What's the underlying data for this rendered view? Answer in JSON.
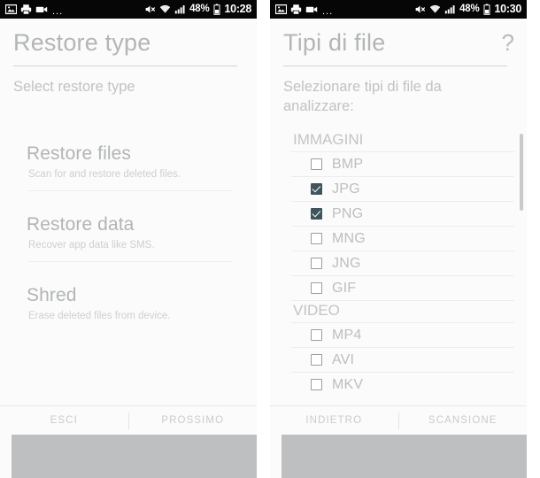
{
  "panels": [
    {
      "id": "restore-type",
      "statusbar": {
        "icons": [
          "image-icon",
          "print-icon",
          "video-icon"
        ],
        "overflow": "...",
        "mute_icon": "mute-icon",
        "wifi_icon": "wifi-icon",
        "signal_icon": "signal-icon",
        "battery_pct": "48%",
        "battery_icon": "battery-icon",
        "time": "10:28"
      },
      "header": {
        "title": "Restore type",
        "help": "",
        "subtitle": "Select restore type"
      },
      "menu": [
        {
          "title": "Restore files",
          "subtitle": "Scan for and restore deleted files."
        },
        {
          "title": "Restore data",
          "subtitle": "Recover app data like SMS."
        },
        {
          "title": "Shred",
          "subtitle": "Erase deleted files from device."
        }
      ],
      "actions": {
        "left": "ESCI",
        "right": "PROSSIMO"
      }
    },
    {
      "id": "file-types",
      "statusbar": {
        "icons": [
          "image-icon",
          "print-icon",
          "video-icon"
        ],
        "overflow": "...",
        "mute_icon": "mute-icon",
        "wifi_icon": "wifi-icon",
        "signal_icon": "signal-icon",
        "battery_pct": "48%",
        "battery_icon": "battery-icon",
        "time": "10:30"
      },
      "header": {
        "title": "Tipi di file",
        "help": "?",
        "subtitle": "Selezionare tipi di file da analizzare:"
      },
      "groups": [
        {
          "name": "IMMAGINI",
          "items": [
            {
              "label": "BMP",
              "checked": false
            },
            {
              "label": "JPG",
              "checked": true
            },
            {
              "label": "PNG",
              "checked": true
            },
            {
              "label": "MNG",
              "checked": false
            },
            {
              "label": "JNG",
              "checked": false
            },
            {
              "label": "GIF",
              "checked": false
            }
          ]
        },
        {
          "name": "VIDEO",
          "items": [
            {
              "label": "MP4",
              "checked": false
            },
            {
              "label": "AVI",
              "checked": false
            },
            {
              "label": "MKV",
              "checked": false
            }
          ]
        }
      ],
      "actions": {
        "left": "INDIETRO",
        "right": "SCANSIONE"
      }
    }
  ],
  "colors": {
    "statusbar_bg": "#060606",
    "page_bg": "#fbfbfb",
    "text_muted": "#bcbebf",
    "checkbox_checked": "#3f545c",
    "nav_block": "#bebfc0",
    "rule": "#ededee"
  }
}
